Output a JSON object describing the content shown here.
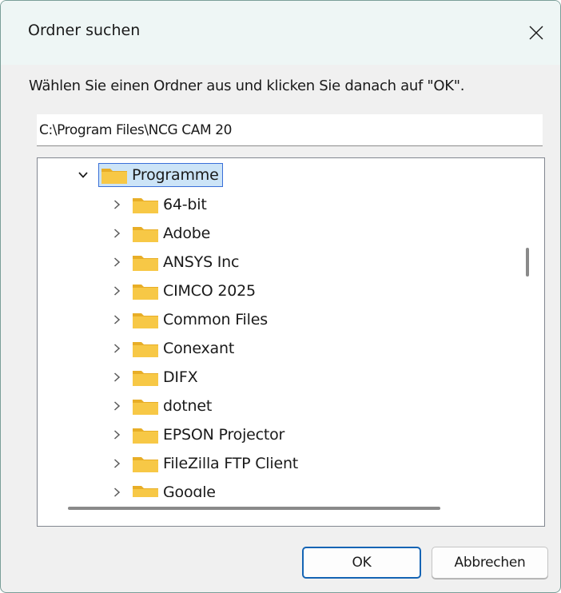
{
  "window": {
    "title": "Ordner suchen",
    "close_glyph": "✕"
  },
  "instruction": "Wählen Sie einen Ordner aus und klicken Sie danach auf \"OK\".",
  "path_field": {
    "value": "C:\\Program Files\\NCG CAM 20"
  },
  "tree": {
    "root": {
      "label": "Programme",
      "expanded": true,
      "selected": true,
      "icon": "folder-icon"
    },
    "children": [
      {
        "label": "64-bit"
      },
      {
        "label": "Adobe"
      },
      {
        "label": "ANSYS Inc"
      },
      {
        "label": "CIMCO 2025"
      },
      {
        "label": "Common Files"
      },
      {
        "label": "Conexant"
      },
      {
        "label": "DIFX"
      },
      {
        "label": "dotnet"
      },
      {
        "label": "EPSON Projector"
      },
      {
        "label": "FileZilla FTP Client"
      },
      {
        "label": "Google"
      }
    ]
  },
  "buttons": {
    "ok_label": "OK",
    "cancel_label": "Abbrechen"
  },
  "colors": {
    "accent": "#1464b4",
    "selection_bg": "#cce4f7",
    "selection_border": "#3a6fd8",
    "folder_body": "#f7c846",
    "folder_tab": "#e8ae27",
    "titlebar_bg": "#eef6f5"
  }
}
